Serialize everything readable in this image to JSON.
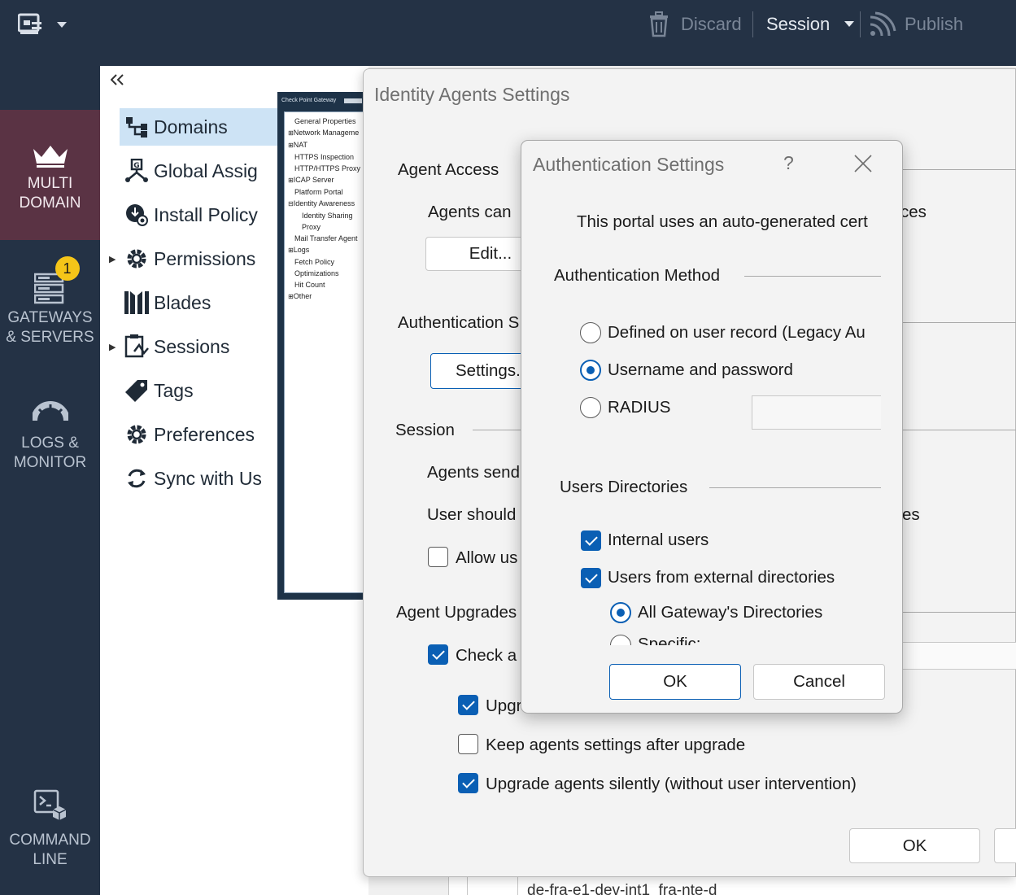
{
  "topbar": {
    "discard": "Discard",
    "session": "Session",
    "publish": "Publish"
  },
  "leftnav": {
    "multi_domain": [
      "MULTI",
      "DOMAIN"
    ],
    "gateways": [
      "GATEWAYS",
      "& SERVERS"
    ],
    "gateways_badge": "1",
    "logs": [
      "LOGS &",
      "MONITOR"
    ],
    "command": [
      "COMMAND",
      "LINE"
    ]
  },
  "secondary": {
    "items": [
      {
        "label": "Domains"
      },
      {
        "label": "Global Assig"
      },
      {
        "label": "Install Policy"
      },
      {
        "label": "Permissions"
      },
      {
        "label": "Blades"
      },
      {
        "label": "Sessions"
      },
      {
        "label": "Tags"
      },
      {
        "label": "Preferences"
      },
      {
        "label": "Sync with Us"
      }
    ]
  },
  "thumbnail": {
    "title": "Check Point Gateway",
    "tree": [
      "General Properties",
      "Network Manageme",
      "NAT",
      "HTTPS Inspection",
      "HTTP/HTTPS Proxy",
      "ICAP Server",
      "Platform Portal",
      "Identity Awareness",
      "Identity Sharing",
      "Proxy",
      "Mail Transfer Agent",
      "Logs",
      "Fetch Policy",
      "Optimizations",
      "Hit Count",
      "Other"
    ]
  },
  "identity_dialog": {
    "title": "Identity Agents Settings",
    "agent_access": "Agent Access",
    "agents_can": "Agents can",
    "ces": "ces",
    "edit_button": "Edit...",
    "authentication_s": "Authentication S",
    "settings_button": "Settings.",
    "session": "Session",
    "agents_send": "Agents send",
    "user_should": "User should",
    "es": "es",
    "allow_us": "Allow us",
    "agent_upgrades": "Agent Upgrades",
    "check_a": "Check a",
    "upgr": "Upgr",
    "keep_settings": "Keep agents settings after upgrade",
    "upgrade_silently": "Upgrade agents silently (without user intervention)",
    "ok_button": "OK",
    "bottom_text": "de-fra-e1-dev-int1_fra-nte-d"
  },
  "auth_dialog": {
    "title": "Authentication Settings",
    "help": "?",
    "close": "×",
    "portal_text": "This portal uses an auto-generated cert",
    "auth_method": "Authentication Method",
    "defined_on_user": "Defined on user record  (Legacy Au",
    "username_password": "Username and password",
    "radius": "RADIUS",
    "users_directories": "Users Directories",
    "internal_users": "Internal users",
    "external_users": "Users from external directories",
    "all_gateway_dirs": "All Gateway's Directories",
    "specific": "Specific:",
    "ok_button": "OK",
    "cancel_button": "Cancel"
  }
}
